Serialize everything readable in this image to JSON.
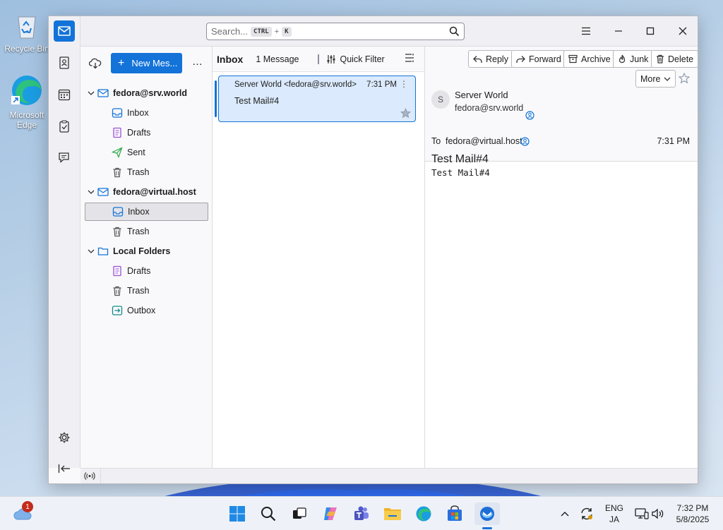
{
  "desktop": {
    "recycle_bin": "Recycle Bin",
    "edge": "Microsoft\nEdge"
  },
  "search": {
    "placeholder": "Search...",
    "key1": "CTRL",
    "plus": "+",
    "key2": "K"
  },
  "folder_pane": {
    "new_message": "New Mes...",
    "more": "…",
    "accounts": [
      {
        "name": "fedora@srv.world",
        "folders": [
          "Inbox",
          "Drafts",
          "Sent",
          "Trash"
        ]
      },
      {
        "name": "fedora@virtual.host",
        "folders": [
          "Inbox",
          "Trash"
        ]
      },
      {
        "name": "Local Folders",
        "folders": [
          "Drafts",
          "Trash",
          "Outbox"
        ]
      }
    ]
  },
  "thread_pane": {
    "folder": "Inbox",
    "count": "1 Message",
    "quick_filter": "Quick Filter",
    "message": {
      "from": "Server World <fedora@srv.world>",
      "time": "7:31 PM",
      "subject": "Test Mail#4"
    }
  },
  "reader": {
    "buttons": {
      "reply": "Reply",
      "forward": "Forward",
      "archive": "Archive",
      "junk": "Junk",
      "delete": "Delete",
      "more": "More"
    },
    "avatar_letter": "S",
    "from_name": "Server World",
    "from_email": "fedora@srv.world",
    "to_label": "To",
    "to": "fedora@virtual.host",
    "time": "7:31 PM",
    "subject": "Test Mail#4",
    "body": "Test Mail#4"
  },
  "taskbar": {
    "weather_badge": "1",
    "lang1": "ENG",
    "lang2": "JA",
    "time": "7:32 PM",
    "date": "5/8/2025"
  },
  "colors": {
    "accent": "#1373d9",
    "selected_card": "#dbeafc"
  }
}
